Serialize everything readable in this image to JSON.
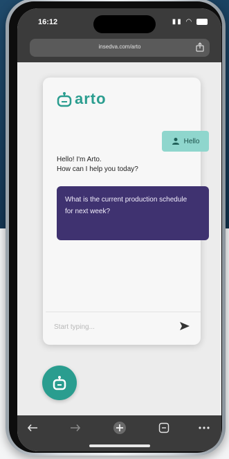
{
  "status_bar": {
    "time": "16:12"
  },
  "browser": {
    "url": "insedva.com/arto"
  },
  "chat": {
    "logo_text": "arto",
    "user_message": "Hello",
    "bot_greeting_line1": "Hello! I'm Arto.",
    "bot_greeting_line2": "How can I help you today?",
    "question": "What is the current production schedule for next week?",
    "input_placeholder": "Start typing..."
  },
  "colors": {
    "brand_teal": "#2a9d8f",
    "user_bubble": "#8fd6cd",
    "question_bubble": "#3f3270",
    "background_dark": "#1f4a6b"
  },
  "icons": {
    "logo": "robot-icon",
    "user": "person-icon",
    "send": "send-icon",
    "fab": "robot-icon",
    "back": "arrow-left-icon",
    "forward": "arrow-right-icon",
    "new_tab": "plus-icon",
    "tabs": "tabs-icon",
    "more": "more-icon",
    "share": "share-icon"
  }
}
